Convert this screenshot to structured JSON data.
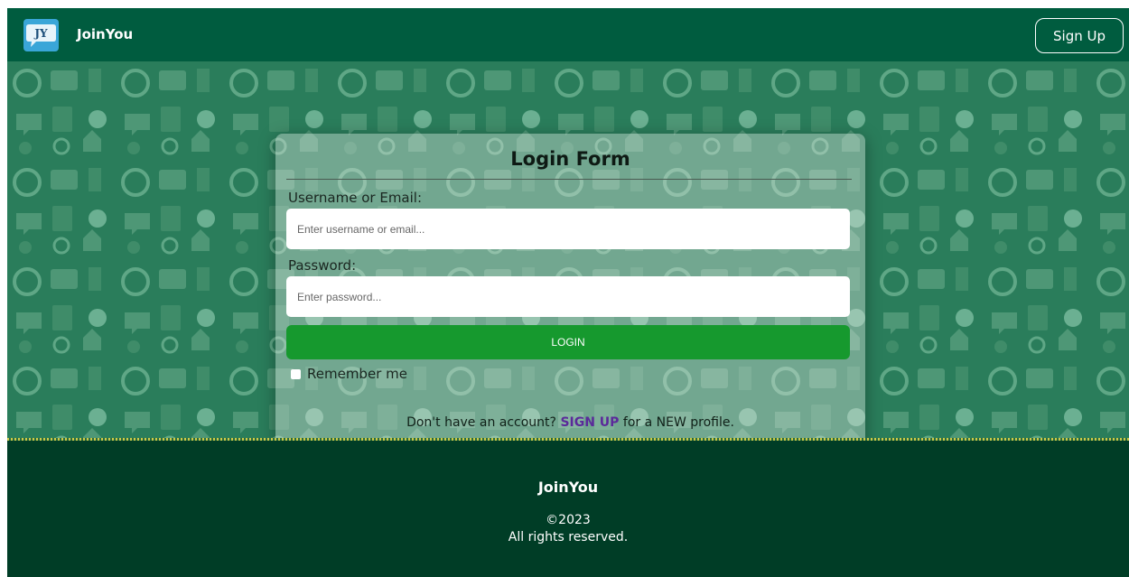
{
  "header": {
    "logo_text": "JY",
    "brand": "JoinYou",
    "signup_label": "Sign Up"
  },
  "login_form": {
    "title": "Login Form",
    "username_label": "Username or Email:",
    "username_placeholder": "Enter username or email...",
    "username_value": "",
    "password_label": "Password:",
    "password_placeholder": "Enter password...",
    "password_value": "",
    "login_button": "LOGIN",
    "remember_label": "Remember me",
    "remember_checked": false,
    "signup_prefix": "Don't have an account?",
    "signup_link": "SIGN UP",
    "signup_suffix": "for a NEW profile."
  },
  "footer": {
    "brand": "JoinYou",
    "copyright": "©2023",
    "rights": "All rights reserved."
  },
  "colors": {
    "header_bg": "#005c3f",
    "hero_bg": "#2a7d5b",
    "login_button": "#16992e",
    "signup_link": "#5b2a9a",
    "footer_bg": "#003d26"
  },
  "icons": [
    "logo-speech-bubble-icon",
    "social-media-pattern-background"
  ]
}
